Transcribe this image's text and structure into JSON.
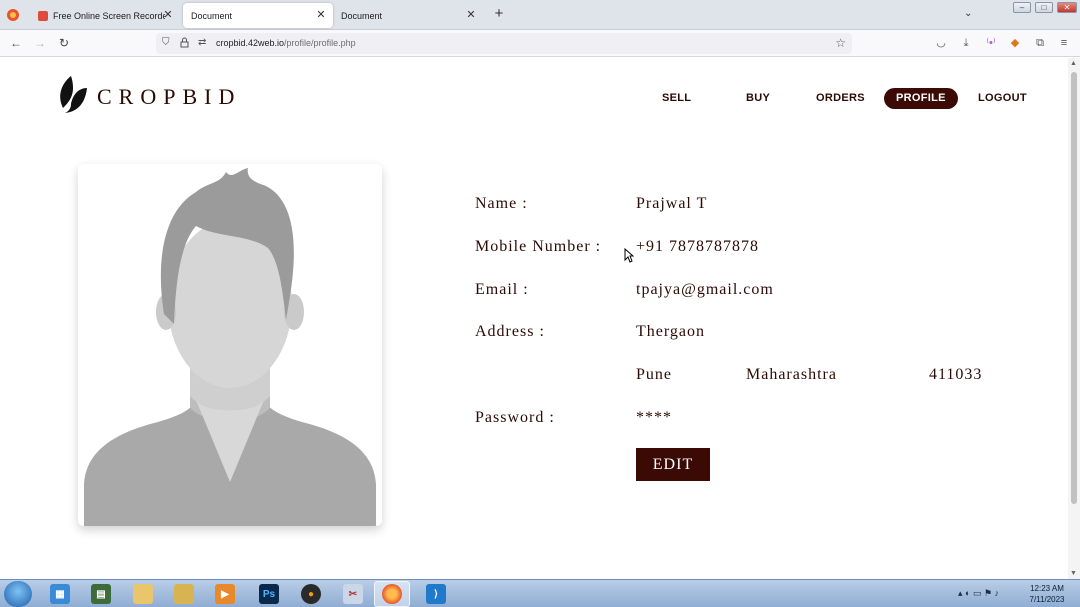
{
  "browser": {
    "tabs": [
      {
        "label": "Free Online Screen Recorder & S",
        "active": false
      },
      {
        "label": "Document",
        "active": true
      },
      {
        "label": "Document",
        "active": false
      }
    ],
    "url_domain": "cropbid.42web.io",
    "url_path": "/profile/profile.php"
  },
  "site": {
    "logo_text": "CROPBID",
    "nav": [
      {
        "label": "SELL"
      },
      {
        "label": "BUY"
      },
      {
        "label": "ORDERS"
      },
      {
        "label": "PROFILE",
        "active": true
      },
      {
        "label": "LOGOUT"
      }
    ]
  },
  "profile": {
    "name_label": "Name :",
    "name_value": "Prajwal T",
    "mobile_label": "Mobile Number :",
    "mobile_value": "+91 7878787878",
    "email_label": "Email :",
    "email_value": "tpajya@gmail.com",
    "address_label": "Address :",
    "address_line1": "Thergaon",
    "city": "Pune",
    "state": "Maharashtra",
    "pincode": "411033",
    "password_label": "Password :",
    "password_value": "****",
    "edit_label": "EDIT"
  },
  "taskbar": {
    "time": "12:23 AM",
    "date": "7/11/2023"
  },
  "colors": {
    "brand": "#3b0a04",
    "text": "#2b0b05"
  }
}
